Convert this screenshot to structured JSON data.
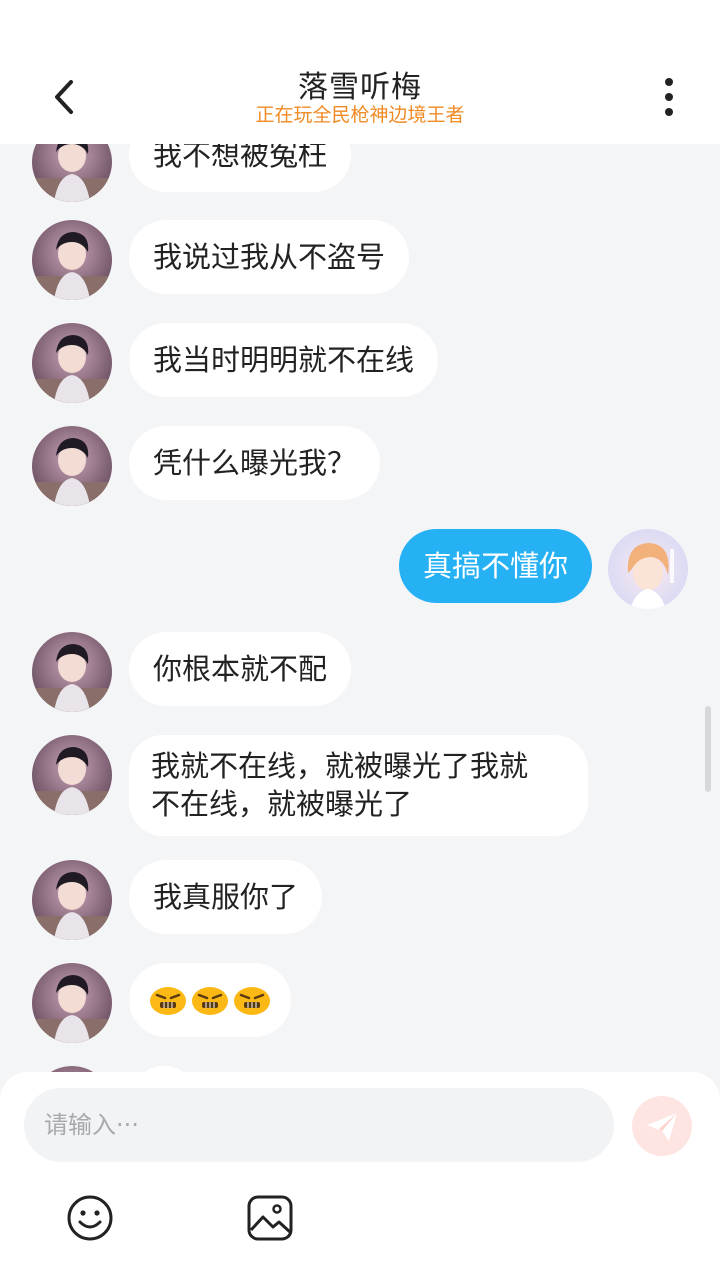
{
  "header": {
    "title": "落雪听梅",
    "subtitle": "正在玩全民枪神边境王者"
  },
  "messages": [
    {
      "from": "other",
      "text": "我不想被冤枉"
    },
    {
      "from": "other",
      "text": "我说过我从不盗号"
    },
    {
      "from": "other",
      "text": "我当时明明就不在线"
    },
    {
      "from": "other",
      "text": "凭什么曝光我？"
    },
    {
      "from": "me",
      "text": "真搞不懂你"
    },
    {
      "from": "other",
      "text": "你根本就不配"
    },
    {
      "from": "other",
      "text_line1": "我就不在线，就被曝光了我就",
      "text_line2": "不在线，就被曝光了"
    },
    {
      "from": "other",
      "text": "我真服你了"
    },
    {
      "from": "other",
      "emojis": [
        "angry-face-emoji",
        "angry-face-emoji",
        "angry-face-emoji"
      ]
    }
  ],
  "input": {
    "placeholder": "请输入···"
  },
  "icons": {
    "back": "chevron-left-icon",
    "more": "more-vertical-icon",
    "send": "send-icon",
    "emoji": "smiley-icon",
    "image": "image-icon"
  },
  "colors": {
    "accent": "#26b1f5",
    "subtitle": "#f08a24",
    "background": "#f4f5f7",
    "send_button": "#ffe5e1"
  }
}
